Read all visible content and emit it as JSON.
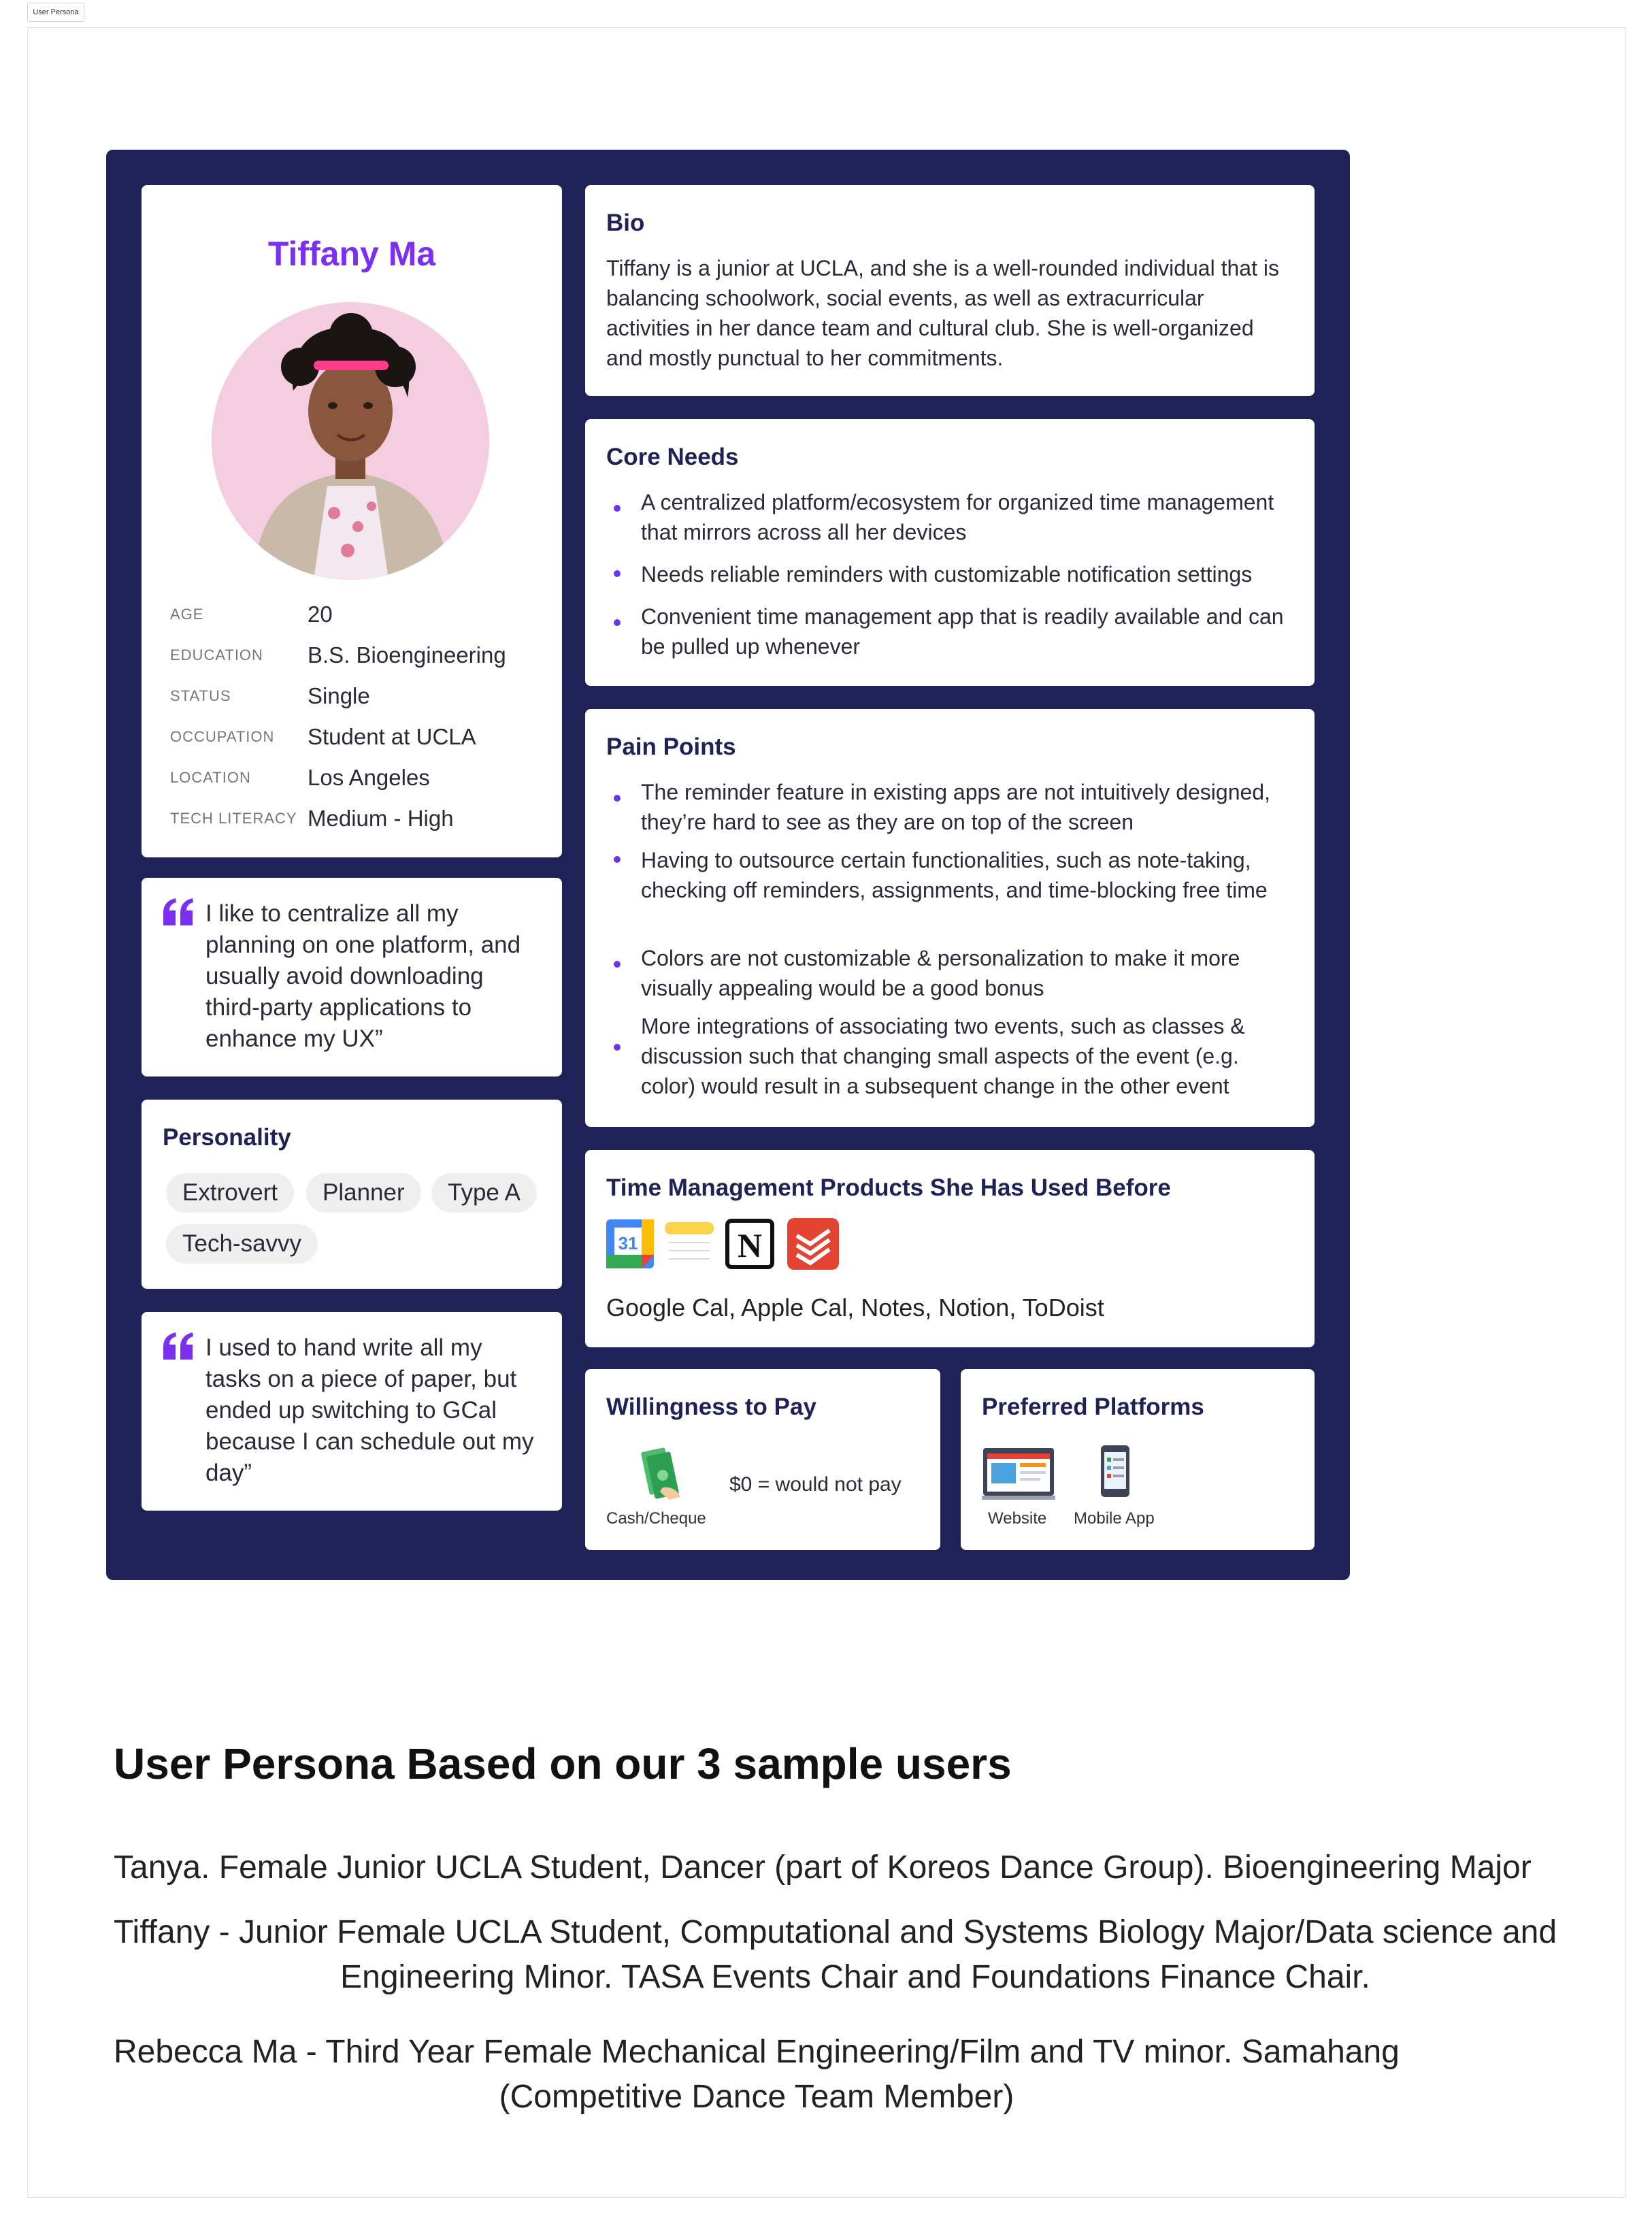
{
  "frame": {
    "tab_label": "User Persona"
  },
  "profile": {
    "name": "Tiffany Ma",
    "info": [
      {
        "key": "AGE",
        "value": "20"
      },
      {
        "key": "EDUCATION",
        "value": "B.S. Bioengineering"
      },
      {
        "key": "STATUS",
        "value": "Single"
      },
      {
        "key": "OCCUPATION",
        "value": "Student at UCLA"
      },
      {
        "key": "LOCATION",
        "value": "Los Angeles"
      },
      {
        "key": "TECH LITERACY",
        "value": "Medium - High"
      }
    ]
  },
  "quotes": [
    "I like to centralize all my planning on one platform, and usually avoid downloading third-party applications to enhance my UX”",
    "I used to hand write all my tasks on a piece of paper, but ended up switching to GCal because I can schedule out my day”"
  ],
  "personality": {
    "title": "Personality",
    "tags": [
      "Extrovert",
      "Planner",
      "Type A",
      "Tech-savvy"
    ]
  },
  "bio": {
    "title": "Bio",
    "text": "Tiffany is a junior at UCLA, and she is a well-rounded individual that is balancing schoolwork, social events, as well as extracurricular activities in her dance team and cultural club. She is well-organized and mostly punctual to her commitments."
  },
  "core_needs": {
    "title": "Core Needs",
    "items": [
      "A centralized platform/ecosystem for organized time management that mirrors across all her devices",
      "Needs reliable reminders with customizable notification settings",
      "Convenient time management app that is readily available and can be pulled up whenever"
    ]
  },
  "pain_points": {
    "title": "Pain Points",
    "items": [
      "The reminder feature in existing apps are not intuitively designed, they’re hard to see as they are on top of the screen",
      "Having to outsource certain functionalities, such as note-taking, checking off reminders, assignments, and time-blocking free time",
      "Colors are not customizable & personalization to make it more visually appealing would be a good bonus",
      "More integrations of associating two events, such as classes & discussion such that changing small aspects of the event (e.g. color) would result in a subsequent change in the other event"
    ]
  },
  "products": {
    "title": "Time Management Products She Has Used Before",
    "icons": [
      "google-calendar-icon",
      "apple-notes-icon",
      "notion-icon",
      "todoist-icon"
    ],
    "gcal_day": "31",
    "notion_letter": "N",
    "list": "Google Cal, Apple Cal, Notes, Notion, ToDoist"
  },
  "willingness": {
    "title": "Willingness to Pay",
    "method_label": "Cash/Cheque",
    "amount": "$0 = would not pay"
  },
  "platforms": {
    "title": "Preferred Platforms",
    "items": [
      "Website",
      "Mobile App"
    ]
  },
  "summary": {
    "title": "User Persona Based on our 3 sample users",
    "users": [
      [
        "Tanya. Female Junior UCLA Student, Dancer (part of Koreos Dance Group). Bioengineering Major"
      ],
      [
        "Tiffany - Junior Female UCLA Student, Computational and Systems Biology Major/Data science and",
        "Engineering Minor. TASA Events Chair and Foundations Finance Chair."
      ],
      [
        "Rebecca Ma - Third Year Female Mechanical Engineering/Film and TV minor. Samahang",
        "(Competitive Dance Team Member)"
      ]
    ]
  },
  "colors": {
    "board": "#1e2256",
    "accent": "#7b2ff2",
    "bullet": "#6a35e8"
  }
}
